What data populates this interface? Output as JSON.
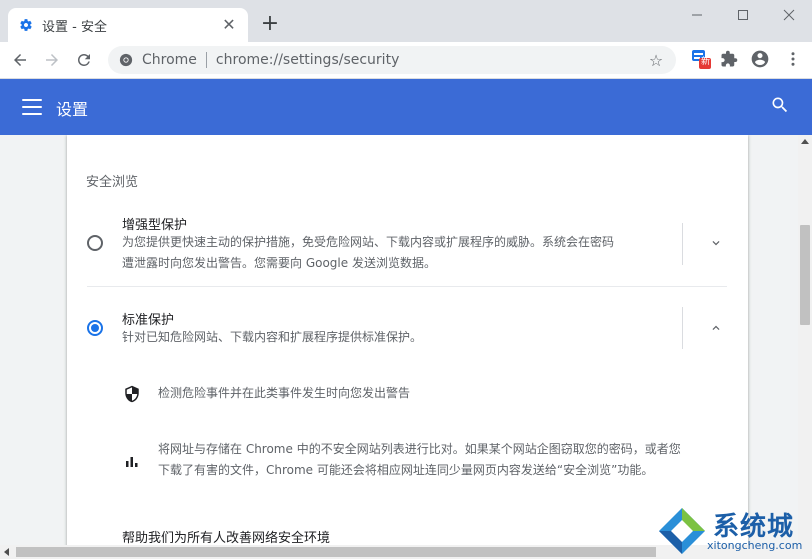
{
  "browser": {
    "tab_title": "设置 - 安全",
    "omnibox_site_label": "Chrome",
    "url": "chrome://settings/security",
    "extension_badge": "新"
  },
  "header": {
    "title": "设置"
  },
  "safe_browsing": {
    "section_title": "安全浏览",
    "options": [
      {
        "title": "增强型保护",
        "description_line1": "为您提供更快速主动的保护措施，免受危险网站、下载内容或扩展程序的威胁。系统会在密码",
        "description_line2": "遭泄露时向您发出警告。您需要向 Google 发送浏览数据。",
        "selected": false
      },
      {
        "title": "标准保护",
        "description_line1": "针对已知危险网站、下载内容和扩展程序提供标准保护。",
        "selected": true
      }
    ],
    "details": [
      {
        "icon": "shield-icon",
        "text": "检测危险事件并在此类事件发生时向您发出警告"
      },
      {
        "icon": "bar-chart-icon",
        "text_line1": "将网址与存储在 Chrome 中的不安全网站列表进行比对。如果某个网站企图窃取您的密码，或者您",
        "text_line2": "下载了有害的文件，Chrome 可能还会将相应网址连同少量网页内容发送给“安全浏览”功能。"
      }
    ],
    "help_title": "帮助我们为所有人改善网络安全环境"
  },
  "watermark": {
    "name": "系统城",
    "domain": "xitongcheng.com"
  },
  "colors": {
    "header_blue": "#3b6bd6",
    "radio_blue": "#1a73e8"
  }
}
